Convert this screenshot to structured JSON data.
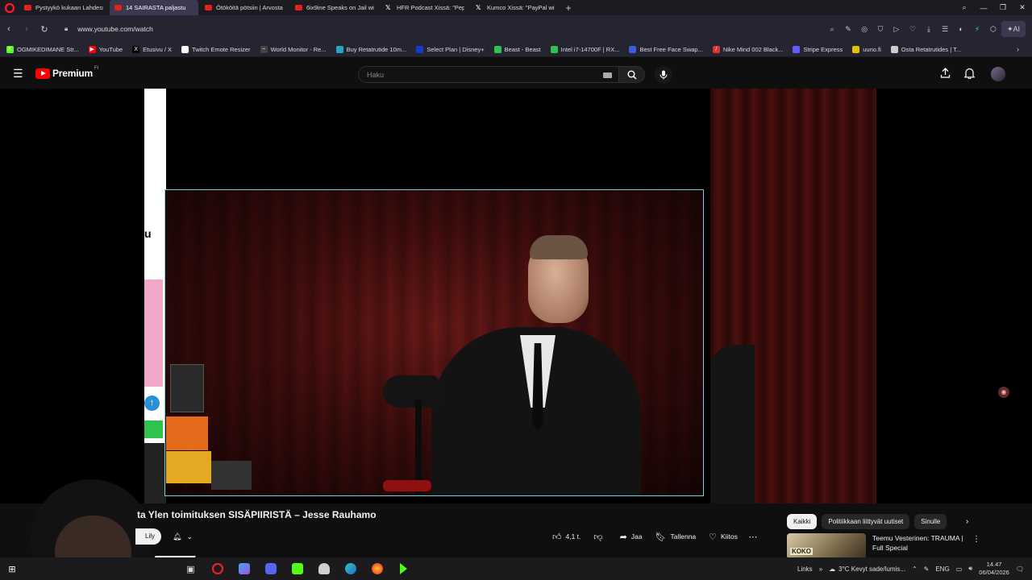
{
  "browser": {
    "tabs": [
      {
        "label": "Pystyykö kukaan Lahdess",
        "icon": "youtube-icon",
        "active": false
      },
      {
        "label": "14 SAIRASTA paljastu",
        "icon": "youtube-icon",
        "active": true
      },
      {
        "label": "Ötököitä pötsiin | Arvosta",
        "icon": "youtube-icon",
        "active": false
      },
      {
        "label": "6ix9ine Speaks on Jail with",
        "icon": "youtube-icon",
        "active": false
      },
      {
        "label": "HFR Podcast Xissä: \"Pepp",
        "icon": "x-icon",
        "active": false
      },
      {
        "label": "Kumco Xissä: \"PayPal will",
        "icon": "x-icon",
        "active": false
      }
    ],
    "url": "www.youtube.com/watch",
    "ai_label": "AI",
    "bookmarks": [
      {
        "label": "OGMIKEDIMANE Str...",
        "color": "#53fc18",
        "glyph": "K"
      },
      {
        "label": "YouTube",
        "color": "#ff0000",
        "glyph": "▶"
      },
      {
        "label": "Etusivu / X",
        "color": "#000000",
        "glyph": "X"
      },
      {
        "label": "Twitch Emote Resizer",
        "color": "#ffffff",
        "glyph": ""
      },
      {
        "label": "World Monitor - Re...",
        "color": "#444444",
        "glyph": "~"
      },
      {
        "label": "Buy Retatrutide 10m...",
        "color": "#2aa3c9",
        "glyph": ""
      },
      {
        "label": "Select Plan | Disney+",
        "color": "#113ccf",
        "glyph": ""
      },
      {
        "label": "Beast - Beast",
        "color": "#2fc24f",
        "glyph": ""
      },
      {
        "label": "Intel i7-14700F | RX...",
        "color": "#2fc24f",
        "glyph": ""
      },
      {
        "label": "Best Free Face Swap...",
        "color": "#3b5bdb",
        "glyph": ""
      },
      {
        "label": "Nike Mind 002 Black...",
        "color": "#e03131",
        "glyph": "/"
      },
      {
        "label": "Stripe Express",
        "color": "#635bff",
        "glyph": ""
      },
      {
        "label": "uuno.fi",
        "color": "#e5c100",
        "glyph": ""
      },
      {
        "label": "Osta Retatrutides | T...",
        "color": "#cccccc",
        "glyph": ""
      }
    ]
  },
  "youtube": {
    "logo_text": "Premium",
    "logo_sup": "FI",
    "search_placeholder": "Haku",
    "video_title": "ta Ylen toimituksen SISÄPIIRISTÄ – Jesse Rauhamo",
    "subscribe_label": "Lily",
    "like_count": "4,1 t.",
    "share_label": "Jaa",
    "save_label": "Tallenna",
    "thanks_label": "Kiitos",
    "chips": [
      "Kaikki",
      "Politiikkaan liittyvät uutiset",
      "Sinulle"
    ],
    "recommended": {
      "title": "Teemu Vesterinen: TRAUMA | Full Special",
      "thumb_text": "KOKO"
    }
  },
  "stream_overlay": {
    "left_letter": "u"
  },
  "taskbar": {
    "links_label": "Links",
    "weather": "3°C Kevyt sade/lumis...",
    "language": "ENG",
    "time": "14.47",
    "date": "06/04/2026"
  }
}
